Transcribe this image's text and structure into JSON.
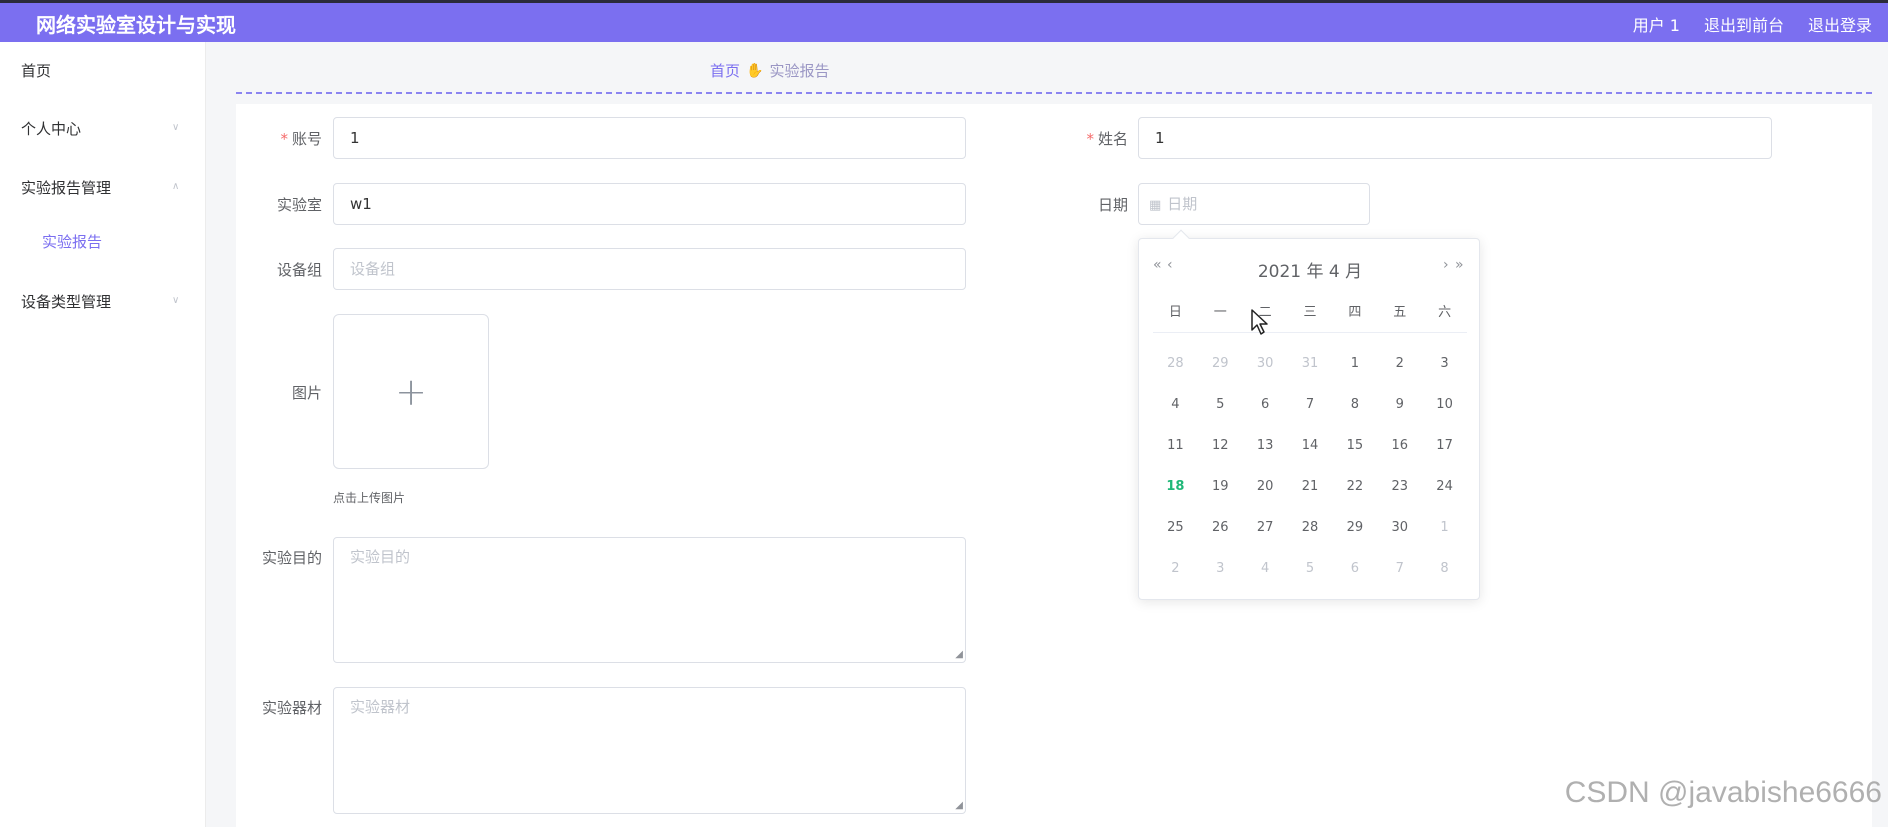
{
  "app": {
    "title": "网络实验室设计与实现"
  },
  "topnav": {
    "user": "用户 1",
    "to_front": "退出到前台",
    "logout": "退出登录"
  },
  "sidebar": {
    "items": [
      {
        "label": "首页"
      },
      {
        "label": "个人中心",
        "arrow": "chevron-down"
      },
      {
        "label": "实验报告管理",
        "arrow": "chevron-up"
      },
      {
        "label": "实验报告",
        "sub": true
      },
      {
        "label": "设备类型管理",
        "arrow": "chevron-down"
      }
    ]
  },
  "breadcrumb": {
    "home": "首页",
    "separator_icon": "hand-icon",
    "current": "实验报告"
  },
  "form": {
    "account": {
      "label": "账号",
      "required": true,
      "value": "1"
    },
    "name": {
      "label": "姓名",
      "required": true,
      "value": "1"
    },
    "lab": {
      "label": "实验室",
      "value": "w1"
    },
    "date": {
      "label": "日期",
      "placeholder": "日期"
    },
    "device_group": {
      "label": "设备组",
      "placeholder": "设备组"
    },
    "image": {
      "label": "图片",
      "tip": "点击上传图片"
    },
    "purpose": {
      "label": "实验目的",
      "placeholder": "实验目的"
    },
    "equipment": {
      "label": "实验器材",
      "placeholder": "实验器材"
    }
  },
  "datepicker": {
    "title": "2021 年  4 月",
    "prev_year": "«",
    "prev_month": "‹",
    "next_month": "›",
    "next_year": "»",
    "weekdays": [
      "日",
      "一",
      "二",
      "三",
      "四",
      "五",
      "六"
    ],
    "days": [
      [
        "28",
        "29",
        "30",
        "31",
        "1",
        "2",
        "3"
      ],
      [
        "4",
        "5",
        "6",
        "7",
        "8",
        "9",
        "10"
      ],
      [
        "11",
        "12",
        "13",
        "14",
        "15",
        "16",
        "17"
      ],
      [
        "18",
        "19",
        "20",
        "21",
        "22",
        "23",
        "24"
      ],
      [
        "25",
        "26",
        "27",
        "28",
        "29",
        "30",
        "1"
      ],
      [
        "2",
        "3",
        "4",
        "5",
        "6",
        "7",
        "8"
      ]
    ],
    "muted_leading": 4,
    "muted_trailing": 8,
    "today": "18",
    "colors": {
      "accent": "#7b6ff0",
      "today": "#20b879",
      "required": "#f56c6c"
    }
  },
  "watermark": "CSDN @javabishe6666"
}
